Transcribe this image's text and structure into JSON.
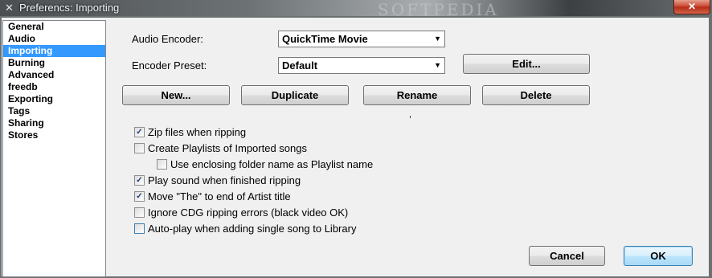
{
  "window": {
    "title": "Preferencs: Importing",
    "close_glyph": "✕",
    "watermark": "SOFTPEDIA"
  },
  "sidebar": {
    "items": [
      {
        "label": "General"
      },
      {
        "label": "Audio"
      },
      {
        "label": "Importing"
      },
      {
        "label": "Burning"
      },
      {
        "label": "Advanced"
      },
      {
        "label": "freedb"
      },
      {
        "label": "Exporting"
      },
      {
        "label": "Tags"
      },
      {
        "label": "Sharing"
      },
      {
        "label": "Stores"
      }
    ],
    "selected": "Importing"
  },
  "form": {
    "encoder_label": "Audio Encoder:",
    "encoder_value": "QuickTime Movie",
    "preset_label": "Encoder Preset:",
    "preset_value": "Default",
    "edit_button": "Edit..."
  },
  "buttons": {
    "new": "New...",
    "duplicate": "Duplicate",
    "rename": "Rename",
    "delete": "Delete",
    "cancel": "Cancel",
    "ok": "OK"
  },
  "options": {
    "zip_files": {
      "label": "Zip files when ripping",
      "checked": true
    },
    "create_playlists": {
      "label": "Create Playlists of Imported songs",
      "checked": false
    },
    "enclosing_folder": {
      "label": "Use enclosing folder name as Playlist name",
      "checked": false
    },
    "play_sound": {
      "label": "Play sound when finished ripping",
      "checked": true
    },
    "move_the": {
      "label": "Move \"The\" to end of Artist title",
      "checked": true
    },
    "ignore_cdg": {
      "label": "Ignore CDG ripping errors (black video OK)",
      "checked": false
    },
    "auto_play": {
      "label": "Auto-play when adding single song to Library",
      "checked": false
    }
  },
  "icons": {
    "app": "app-icon",
    "dropdown": "chevron-down-icon",
    "check_glyph": "✓"
  },
  "colors": {
    "selection": "#3399ff",
    "close": "#c7412b",
    "default_button": "#bee6fd"
  }
}
